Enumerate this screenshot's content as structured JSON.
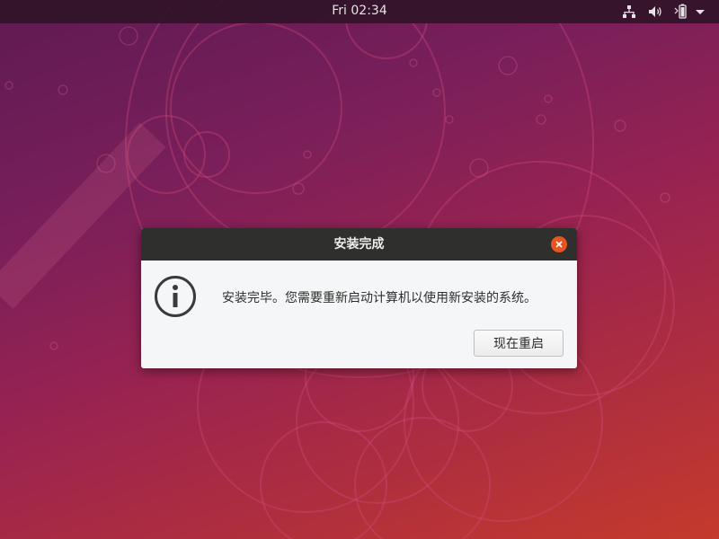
{
  "topbar": {
    "clock": "Fri 02:34",
    "icons": [
      "network-icon",
      "volume-icon",
      "battery-icon",
      "system-menu-arrow-icon"
    ]
  },
  "dialog": {
    "title": "安装完成",
    "message": "安装完毕。您需要重新启动计算机以使用新安装的系统。",
    "restart_label": "现在重启",
    "close_icon": "close-icon",
    "info_icon": "info-icon"
  },
  "colors": {
    "accent": "#e95420",
    "titlebar": "#2f2f2d",
    "dialog_bg": "#f5f6f7"
  }
}
